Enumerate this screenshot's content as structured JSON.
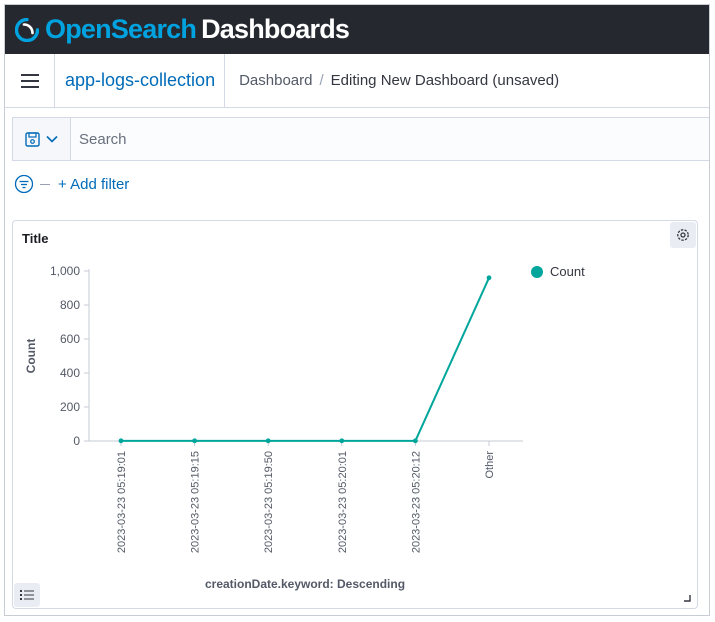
{
  "brand": {
    "open": "Open",
    "search": "Search",
    "dashboards": "Dashboards"
  },
  "header": {
    "app_name": "app-logs-collection",
    "breadcrumbs": [
      "Dashboard",
      "Editing New Dashboard (unsaved)"
    ],
    "separator": "/"
  },
  "query_bar": {
    "placeholder": "Search"
  },
  "filter_bar": {
    "add_filter_label": "+ Add filter"
  },
  "panel": {
    "title": "Title"
  },
  "colors": {
    "accent": "#00a3e0",
    "series": "#00a69b",
    "link": "#006bb8",
    "topbar": "#25282f"
  },
  "icons": [
    "menu-icon",
    "save-icon",
    "chevron-down-icon",
    "filter-icon",
    "gear-icon",
    "legend-list-icon",
    "resize-icon"
  ],
  "chart_data": {
    "type": "line",
    "categories": [
      "2023-03-23 05:19:01",
      "2023-03-23 05:19:15",
      "2023-03-23 05:19:50",
      "2023-03-23 05:20:01",
      "2023-03-23 05:20:12",
      "Other"
    ],
    "series": [
      {
        "name": "Count",
        "values": [
          1,
          1,
          1,
          1,
          1,
          960
        ]
      }
    ],
    "xlabel": "creationDate.keyword: Descending",
    "ylabel": "Count",
    "yticks": [
      "0",
      "200",
      "400",
      "600",
      "800",
      "1,000"
    ],
    "ylim": [
      0,
      1000
    ],
    "legend_position": "top-right",
    "grid": false
  }
}
